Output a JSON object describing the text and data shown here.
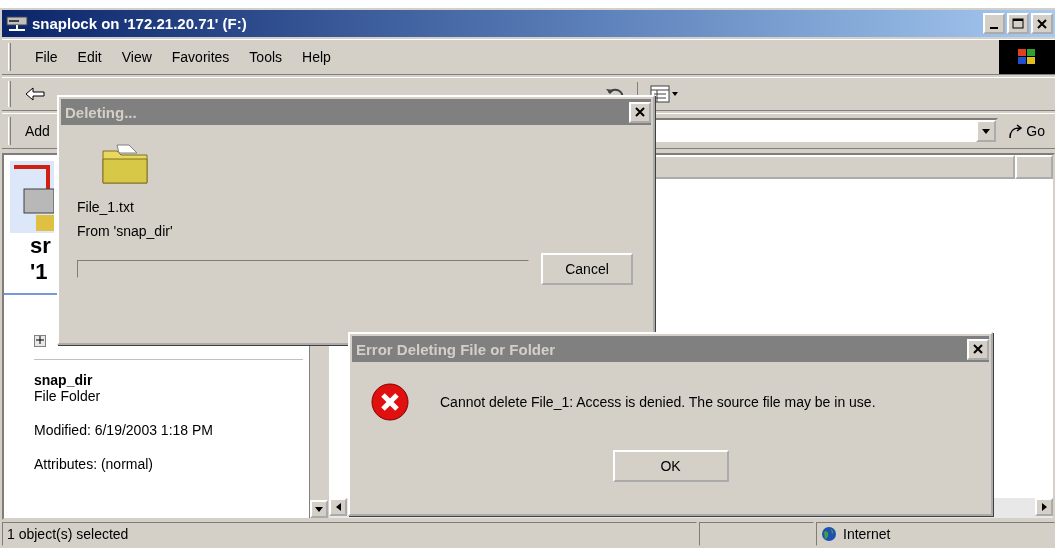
{
  "window": {
    "title": "snaplock on '172.21.20.71' (F:)"
  },
  "menu": [
    "File",
    "Edit",
    "View",
    "Favorites",
    "Tools",
    "Help"
  ],
  "address_bar": {
    "label": "Add",
    "go": "Go"
  },
  "left_pane": {
    "heading_lines": [
      "sr",
      "'1"
    ],
    "name": "snap_dir",
    "type": "File Folder",
    "modified": "Modified: 6/19/2003 1:18 PM",
    "attributes": "Attributes: (normal)"
  },
  "status_bar": {
    "text": "1 object(s) selected",
    "zone": "Internet"
  },
  "deleting_dialog": {
    "title": "Deleting...",
    "file": "File_1.txt",
    "from": "From 'snap_dir'",
    "progress": {
      "level": 0
    },
    "button": "Cancel"
  },
  "error_dialog": {
    "title": "Error Deleting File or Folder",
    "message": "Cannot delete File_1: Access is denied. The source file may be in use.",
    "button": "OK"
  }
}
